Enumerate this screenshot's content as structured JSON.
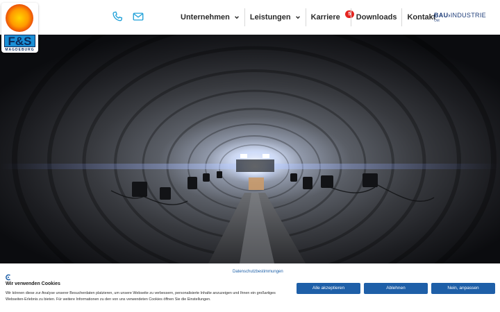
{
  "header": {
    "logo": {
      "text": "F&S",
      "subtext": "MAGDEBURG"
    },
    "contact_icons": [
      "phone-icon",
      "mail-icon"
    ],
    "nav": [
      {
        "label": "Unternehmen",
        "has_dropdown": true
      },
      {
        "label": "Leistungen",
        "has_dropdown": true
      },
      {
        "label": "Karriere",
        "badge": "5"
      },
      {
        "label": "Downloads"
      },
      {
        "label": "Kontakt"
      }
    ],
    "partner": {
      "main_bold": "BAU",
      "main": "INDUSTRIE",
      "sub": "Ost"
    }
  },
  "hero": {
    "image": "tunnel-photo"
  },
  "cookie_banner": {
    "policy_link": "Datenschutzbestimmungen",
    "title": "Wir verwenden Cookies",
    "text": "Wir können diese zur Analyse unserer Besucherdaten platzieren, um unsere Webseite zu verbessern, personalisierte Inhalte anzuzeigen und Ihnen ein großartiges Webseiten-Erlebnis zu bieten. Für weitere Informationen zu den von uns verwendeten Cookies öffnen Sie die Einstellungen.",
    "buttons": {
      "accept": "Alle akzeptieren",
      "decline": "Ablehnen",
      "adjust": "Nein, anpassen"
    }
  },
  "colors": {
    "accent": "#1e5fa8",
    "icon": "#1ea0d8",
    "badge": "#e52521"
  }
}
